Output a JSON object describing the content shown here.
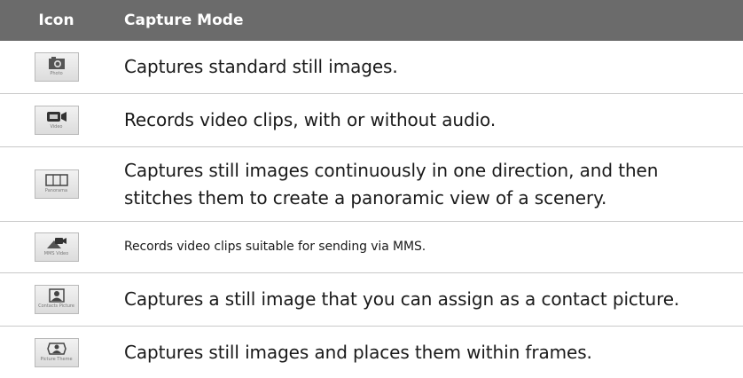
{
  "table": {
    "header": {
      "icon": "Icon",
      "mode": "Capture Mode"
    },
    "rows": [
      {
        "icon_name": "photo-icon",
        "icon_caption": "Photo",
        "text": "Captures standard still images."
      },
      {
        "icon_name": "video-icon",
        "icon_caption": "Video",
        "text": "Records video clips, with or without audio."
      },
      {
        "icon_name": "panorama-icon",
        "icon_caption": "Panorama",
        "text_line1": "Captures still images continuously in one direction, and then",
        "text_line2": "stitches them to create a panoramic view of a scenery."
      },
      {
        "icon_name": "mms-video-icon",
        "icon_caption": "MMS Video",
        "text": "Records video clips suitable for sending via MMS."
      },
      {
        "icon_name": "contact-picture-icon",
        "icon_caption": "Contacts Picture",
        "text": "Captures a still image that you can assign as a contact picture."
      },
      {
        "icon_name": "picture-theme-icon",
        "icon_caption": "Picture Theme",
        "text": "Captures still images and places them within frames."
      }
    ]
  },
  "colors": {
    "header_bg": "#6b6b6b",
    "header_text": "#ffffff",
    "row_divider": "#c9c9c9"
  }
}
